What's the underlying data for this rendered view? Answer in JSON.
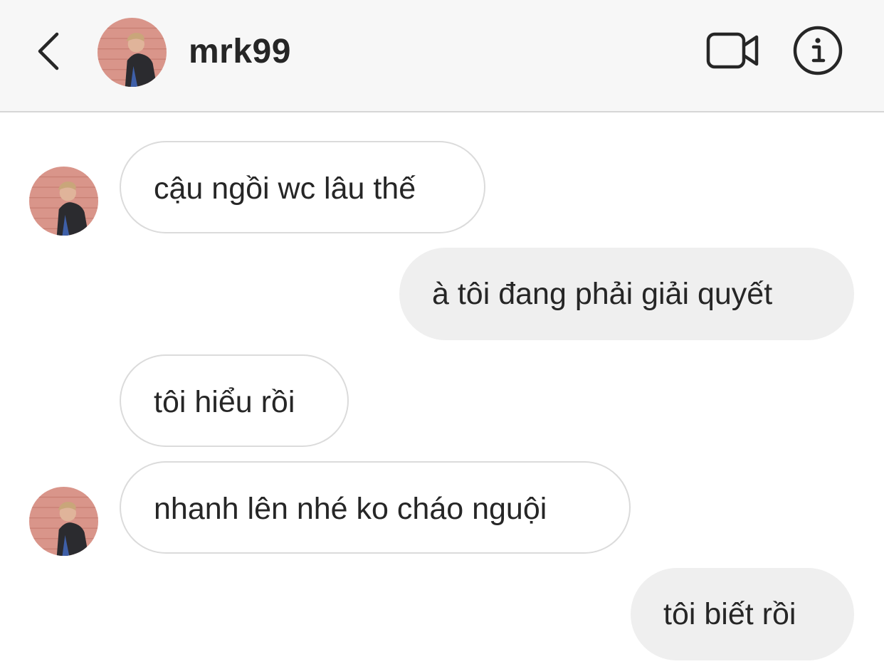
{
  "header": {
    "back_icon": "chevron-left-icon",
    "username": "mrk99",
    "video_icon": "video-camera-icon",
    "info_icon": "info-icon"
  },
  "messages": [
    {
      "direction": "incoming",
      "text": "cậu ngồi wc lâu thế",
      "show_avatar": true
    },
    {
      "direction": "outgoing",
      "text": "à tôi đang phải giải quyết"
    },
    {
      "direction": "incoming",
      "text": "tôi hiểu rồi",
      "show_avatar": false
    },
    {
      "direction": "incoming",
      "text": "nhanh lên nhé ko cháo nguội",
      "show_avatar": true
    },
    {
      "direction": "outgoing",
      "text": "tôi biết rồi"
    }
  ],
  "colors": {
    "header_bg": "#f7f7f7",
    "outgoing_bubble": "#efefef",
    "incoming_border": "#dbdbdb",
    "text": "#262626"
  }
}
